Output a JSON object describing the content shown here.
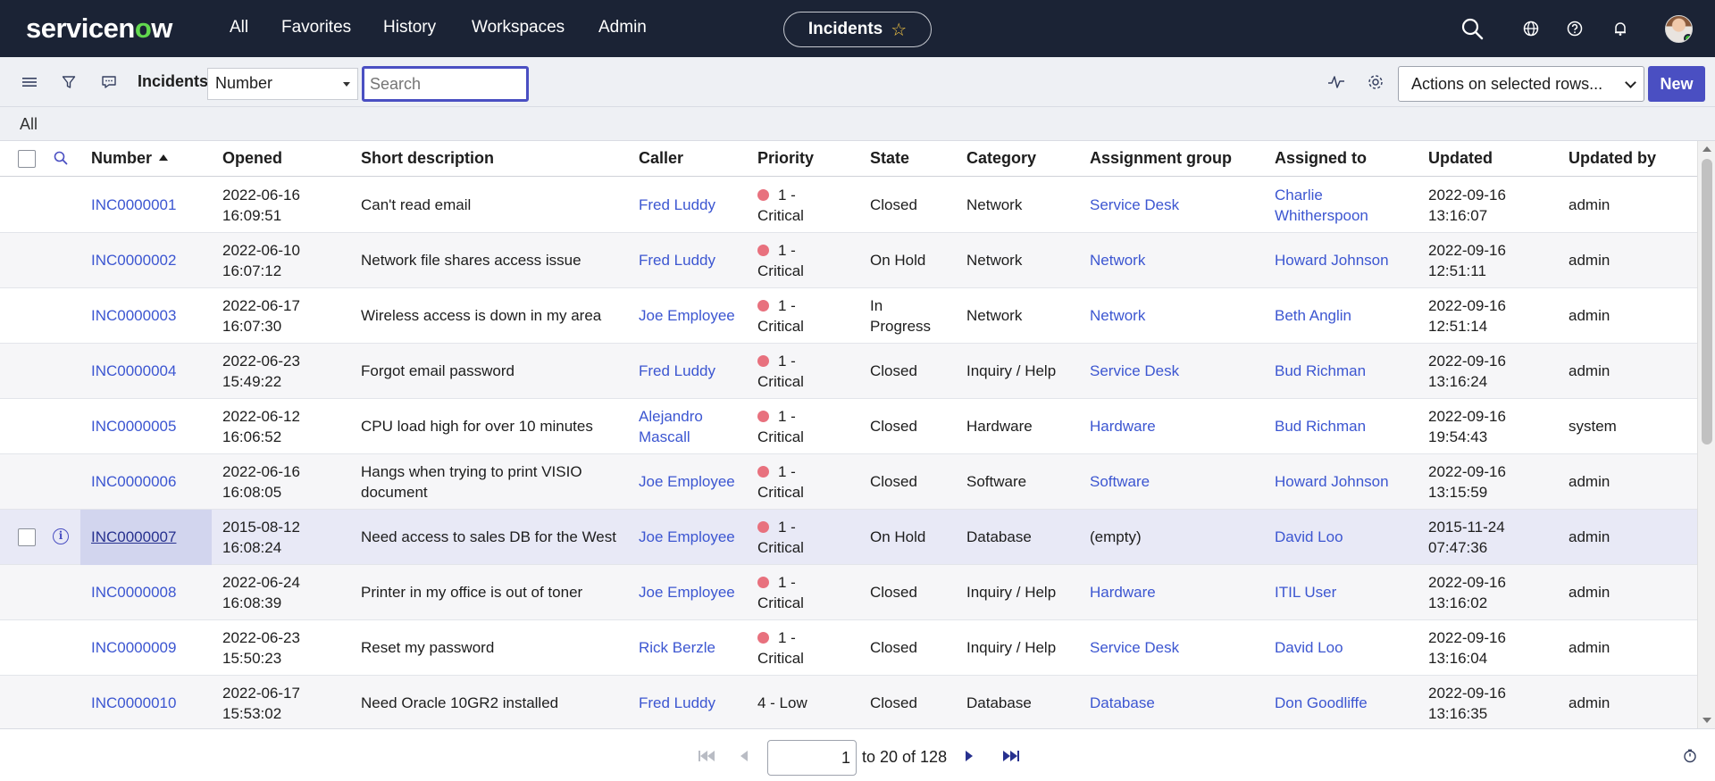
{
  "nav": {
    "logo": "servicenow",
    "menu": [
      "All",
      "Favorites",
      "History",
      "Workspaces",
      "Admin"
    ],
    "context_title": "Incidents"
  },
  "toolbar": {
    "list_label": "Incidents",
    "field_select": "Number",
    "search_placeholder": "Search",
    "actions_select": "Actions on selected rows...",
    "new_button": "New"
  },
  "breadcrumb": "All",
  "columns": [
    "Number",
    "Opened",
    "Short description",
    "Caller",
    "Priority",
    "State",
    "Category",
    "Assignment group",
    "Assigned to",
    "Updated",
    "Updated by"
  ],
  "rows": [
    {
      "number": "INC0000001",
      "opened": [
        "2022-06-16",
        "16:09:51"
      ],
      "desc": [
        "Can't read email"
      ],
      "caller": [
        "Fred Luddy"
      ],
      "priority": [
        "1 -",
        "Critical"
      ],
      "critical": true,
      "state": [
        "Closed"
      ],
      "category": "Network",
      "group": "Service Desk",
      "group_link": true,
      "assigned": [
        "Charlie",
        "Whitherspoon"
      ],
      "updated": [
        "2022-09-16",
        "13:16:07"
      ],
      "updated_by": "admin"
    },
    {
      "number": "INC0000002",
      "opened": [
        "2022-06-10",
        "16:07:12"
      ],
      "desc": [
        "Network file shares access issue"
      ],
      "caller": [
        "Fred Luddy"
      ],
      "priority": [
        "1 -",
        "Critical"
      ],
      "critical": true,
      "state": [
        "On Hold"
      ],
      "category": "Network",
      "group": "Network",
      "group_link": true,
      "assigned": [
        "Howard Johnson"
      ],
      "updated": [
        "2022-09-16",
        "12:51:11"
      ],
      "updated_by": "admin"
    },
    {
      "number": "INC0000003",
      "opened": [
        "2022-06-17",
        "16:07:30"
      ],
      "desc": [
        "Wireless access is down in my area"
      ],
      "caller": [
        "Joe Employee"
      ],
      "priority": [
        "1 -",
        "Critical"
      ],
      "critical": true,
      "state": [
        "In",
        "Progress"
      ],
      "category": "Network",
      "group": "Network",
      "group_link": true,
      "assigned": [
        "Beth Anglin"
      ],
      "updated": [
        "2022-09-16",
        "12:51:14"
      ],
      "updated_by": "admin"
    },
    {
      "number": "INC0000004",
      "opened": [
        "2022-06-23",
        "15:49:22"
      ],
      "desc": [
        "Forgot email password"
      ],
      "caller": [
        "Fred Luddy"
      ],
      "priority": [
        "1 -",
        "Critical"
      ],
      "critical": true,
      "state": [
        "Closed"
      ],
      "category": "Inquiry / Help",
      "group": "Service Desk",
      "group_link": true,
      "assigned": [
        "Bud Richman"
      ],
      "updated": [
        "2022-09-16",
        "13:16:24"
      ],
      "updated_by": "admin"
    },
    {
      "number": "INC0000005",
      "opened": [
        "2022-06-12",
        "16:06:52"
      ],
      "desc": [
        "CPU load high for over 10 minutes"
      ],
      "caller": [
        "Alejandro",
        "Mascall"
      ],
      "priority": [
        "1 -",
        "Critical"
      ],
      "critical": true,
      "state": [
        "Closed"
      ],
      "category": "Hardware",
      "group": "Hardware",
      "group_link": true,
      "assigned": [
        "Bud Richman"
      ],
      "updated": [
        "2022-09-16",
        "19:54:43"
      ],
      "updated_by": "system"
    },
    {
      "number": "INC0000006",
      "opened": [
        "2022-06-16",
        "16:08:05"
      ],
      "desc": [
        "Hangs when trying to print VISIO",
        "document"
      ],
      "caller": [
        "Joe Employee"
      ],
      "priority": [
        "1 -",
        "Critical"
      ],
      "critical": true,
      "state": [
        "Closed"
      ],
      "category": "Software",
      "group": "Software",
      "group_link": true,
      "assigned": [
        "Howard Johnson"
      ],
      "updated": [
        "2022-09-16",
        "13:15:59"
      ],
      "updated_by": "admin"
    },
    {
      "number": "INC0000007",
      "opened": [
        "2015-08-12",
        "16:08:24"
      ],
      "desc": [
        "Need access to sales DB for the West"
      ],
      "caller": [
        "Joe Employee"
      ],
      "priority": [
        "1 -",
        "Critical"
      ],
      "critical": true,
      "state": [
        "On Hold"
      ],
      "category": "Database",
      "group": "(empty)",
      "group_link": false,
      "assigned": [
        "David Loo"
      ],
      "updated": [
        "2015-11-24",
        "07:47:36"
      ],
      "updated_by": "admin"
    },
    {
      "number": "INC0000008",
      "opened": [
        "2022-06-24",
        "16:08:39"
      ],
      "desc": [
        "Printer in my office is out of toner"
      ],
      "caller": [
        "Joe Employee"
      ],
      "priority": [
        "1 -",
        "Critical"
      ],
      "critical": true,
      "state": [
        "Closed"
      ],
      "category": "Inquiry / Help",
      "group": "Hardware",
      "group_link": true,
      "assigned": [
        "ITIL User"
      ],
      "updated": [
        "2022-09-16",
        "13:16:02"
      ],
      "updated_by": "admin"
    },
    {
      "number": "INC0000009",
      "opened": [
        "2022-06-23",
        "15:50:23"
      ],
      "desc": [
        "Reset my password"
      ],
      "caller": [
        "Rick Berzle"
      ],
      "priority": [
        "1 -",
        "Critical"
      ],
      "critical": true,
      "state": [
        "Closed"
      ],
      "category": "Inquiry / Help",
      "group": "Service Desk",
      "group_link": true,
      "assigned": [
        "David Loo"
      ],
      "updated": [
        "2022-09-16",
        "13:16:04"
      ],
      "updated_by": "admin"
    },
    {
      "number": "INC0000010",
      "opened": [
        "2022-06-17",
        "15:53:02"
      ],
      "desc": [
        "Need Oracle 10GR2 installed"
      ],
      "caller": [
        "Fred Luddy"
      ],
      "priority": [
        "4 - Low"
      ],
      "critical": false,
      "state": [
        "Closed"
      ],
      "category": "Database",
      "group": "Database",
      "group_link": true,
      "assigned": [
        "Don Goodliffe"
      ],
      "updated": [
        "2022-09-16",
        "13:16:35"
      ],
      "updated_by": "admin"
    }
  ],
  "hover_row_index": 6,
  "pagination": {
    "page_value": "1",
    "range_text": "to 20 of 128"
  },
  "colors": {
    "nav_bg": "#1b2335",
    "accent": "#4a4fc2",
    "link": "#3c56d1",
    "critical_dot": "#e8717e"
  }
}
